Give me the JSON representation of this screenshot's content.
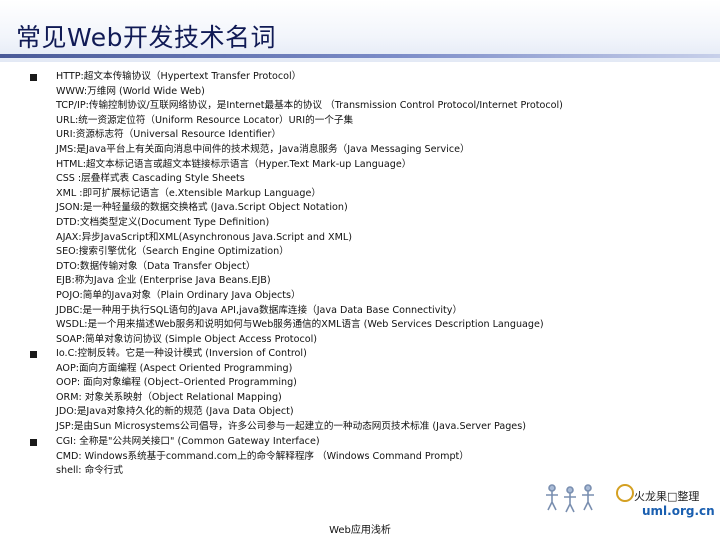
{
  "title": "常见Web开发技术名词",
  "bullets": [
    {
      "lines": [
        "HTTP:超文本传输协议（Hypertext Transfer Protocol）",
        "WWW:万维网 (World Wide Web)",
        "TCP/IP:传输控制协议/互联网络协议，是Internet最基本的协议 （Transmission Control Protocol/Internet Protocol)",
        "URL:统一资源定位符（Uniform Resource Locator）URI的一个子集",
        "URI:资源标志符（Universal Resource Identifier）",
        "JMS:是Java平台上有关面向消息中间件的技术规范，Java消息服务（Java Messaging Service）",
        "HTML:超文本标记语言或超文本链接标示语言（Hyper.Text Mark-up Language）",
        "CSS :层叠样式表 Cascading Style Sheets",
        "XML :即可扩展标记语言（e.Xtensible Markup Language）",
        "JSON:是一种轻量级的数据交换格式 (Java.Script Object Notation)",
        "DTD:文档类型定义(Document Type Definition)",
        "AJAX:异步JavaScript和XML(Asynchronous Java.Script and XML)",
        "SEO:搜索引擎优化（Search Engine Optimization）",
        "DTO:数据传输对象（Data Transfer Object）",
        "EJB:称为Java 企业 (Enterprise Java Beans.EJB)",
        "POJO:简单的Java对象（Plain Ordinary Java Objects）",
        "JDBC:是一种用于执行SQL语句的Java API,java数据库连接（Java Data Base Connectivity）",
        "WSDL:是一个用来描述Web服务和说明如何与Web服务通信的XML语言 (Web Services Description Language)",
        "SOAP:简单对象访问协议 (Simple Object Access Protocol)"
      ]
    },
    {
      "lines": [
        "Io.C:控制反转。它是一种设计模式 (Inversion of Control)",
        "AOP:面向方面编程 (Aspect Oriented Programming)",
        "OOP: 面向对象编程 (Object–Oriented Programming)",
        "ORM: 对象关系映射（Object Relational Mapping)",
        "JDO:是Java对象持久化的新的规范 (Java Data Object)",
        "JSP:是由Sun Microsystems公司倡导，许多公司参与一起建立的一种动态网页技术标准 (Java.Server Pages)"
      ]
    },
    {
      "lines": [
        "CGI: 全称是\"公共网关接口\" (Common Gateway Interface)",
        "CMD: Windows系统基于command.com上的命令解释程序 （Windows Command Prompt）",
        "shell: 命令行式"
      ]
    }
  ],
  "footer": "Web应用浅析",
  "logo": {
    "name": "火龙果□整理",
    "url": "uml.org.cn"
  }
}
